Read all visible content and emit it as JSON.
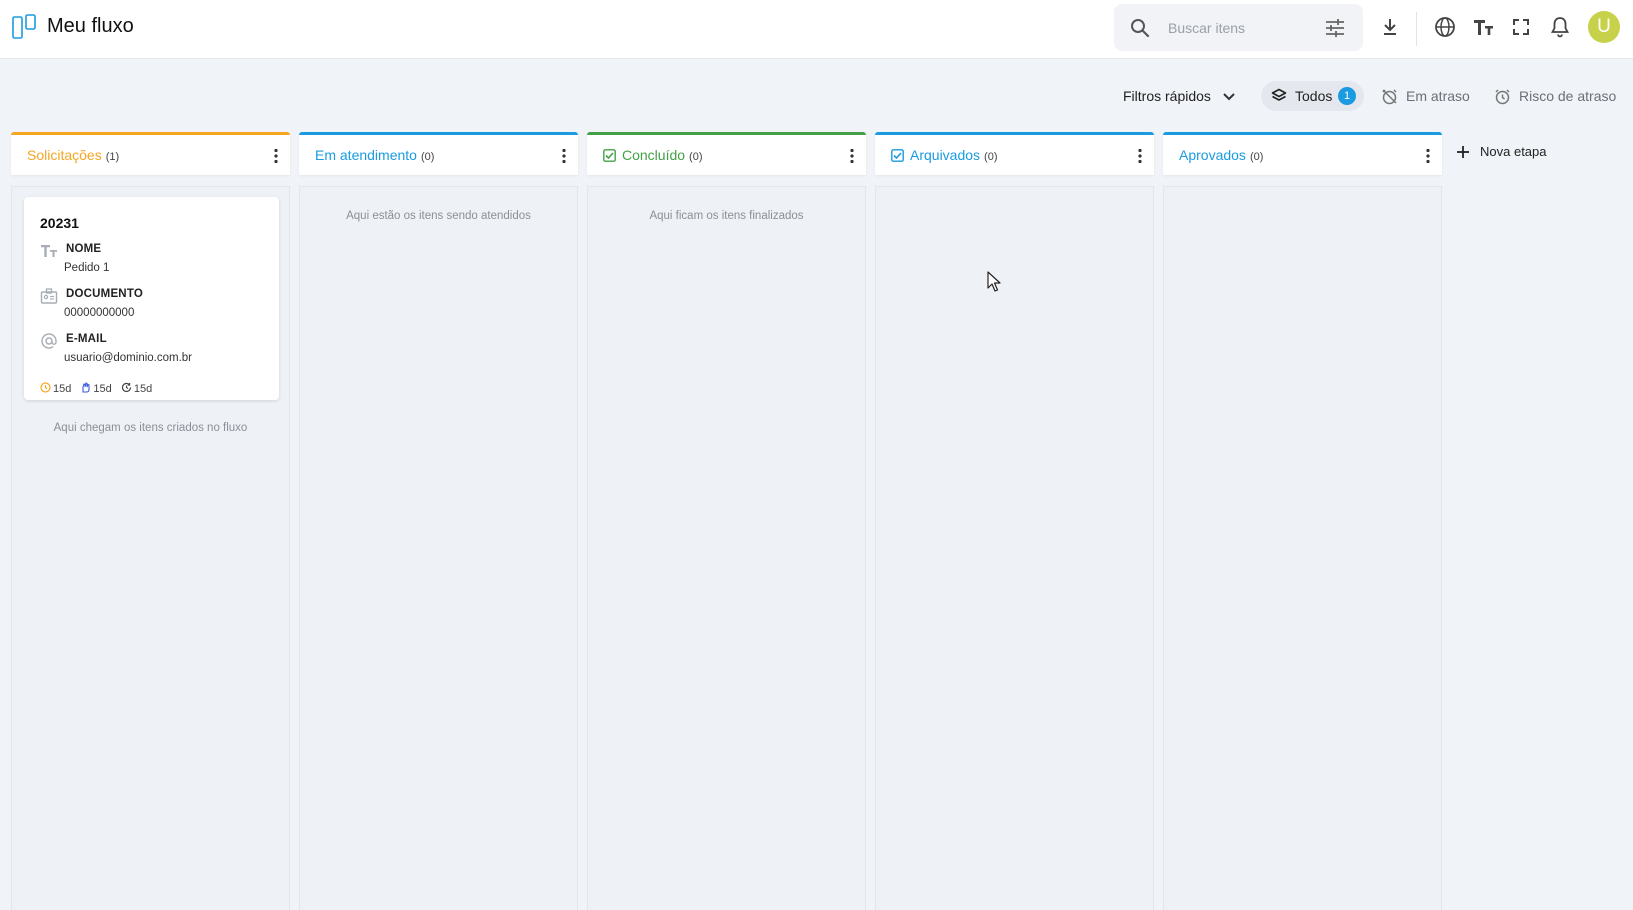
{
  "app": {
    "title": "Meu fluxo"
  },
  "search": {
    "placeholder": "Buscar itens"
  },
  "toolbar": {
    "icons": [
      "download-icon",
      "globe-icon",
      "text-size-icon",
      "fullscreen-icon",
      "bell-icon"
    ],
    "avatar_initial": "U"
  },
  "filters": {
    "quick_filters_label": "Filtros rápidos",
    "all_label": "Todos",
    "all_count": "1",
    "overdue_label": "Em atraso",
    "risk_label": "Risco de atraso"
  },
  "columns": [
    {
      "title": "Solicitações",
      "count": "(1)",
      "color": "#f5a623",
      "empty_text": "Aqui chegam os itens criados no fluxo",
      "check": false
    },
    {
      "title": "Em atendimento",
      "count": "(0)",
      "color": "#1a9be0",
      "empty_text": "Aqui estão os itens sendo atendidos",
      "check": false
    },
    {
      "title": "Concluído",
      "count": "(0)",
      "color": "#43a047",
      "empty_text": "Aqui ficam os itens finalizados",
      "check": true
    },
    {
      "title": "Arquivados",
      "count": "(0)",
      "color": "#1a9be0",
      "empty_text": "",
      "check": true
    },
    {
      "title": "Aprovados",
      "count": "(0)",
      "color": "#1a9be0",
      "empty_text": "",
      "check": false
    }
  ],
  "card": {
    "number": "20231",
    "fields": [
      {
        "label": "NOME",
        "value": "Pedido 1",
        "icon": "text-type-icon"
      },
      {
        "label": "DOCUMENTO",
        "value": "00000000000",
        "icon": "id-card-icon"
      },
      {
        "label": "E-MAIL",
        "value": "usuario@dominio.com.br",
        "icon": "at-sign-icon"
      }
    ],
    "meta": [
      {
        "value": "15d",
        "icon": "clock-icon",
        "color": "#f5a623"
      },
      {
        "value": "15d",
        "icon": "hand-icon",
        "color": "#3b5bdb"
      },
      {
        "value": "15d",
        "icon": "refresh-clock-icon",
        "color": "#444444"
      }
    ]
  },
  "new_stage": {
    "label": "Nova etapa"
  }
}
